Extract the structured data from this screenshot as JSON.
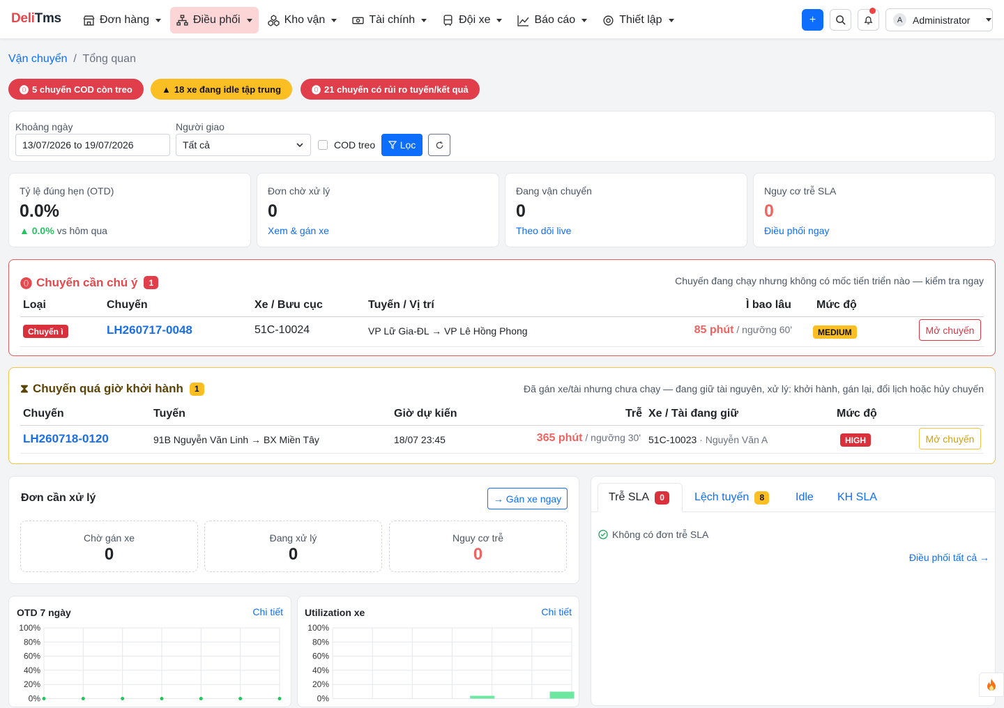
{
  "brand": {
    "a": "Deli",
    "b": "Tms"
  },
  "nav": {
    "items": [
      {
        "label": "Đơn hàng",
        "icon": "store-icon"
      },
      {
        "label": "Điều phối",
        "icon": "org-chart-icon"
      },
      {
        "label": "Kho vận",
        "icon": "boxes-icon"
      },
      {
        "label": "Tài chính",
        "icon": "cash-icon"
      },
      {
        "label": "Đội xe",
        "icon": "bus-icon"
      },
      {
        "label": "Báo cáo",
        "icon": "chart-line-icon"
      },
      {
        "label": "Thiết lập",
        "icon": "gear-icon"
      }
    ],
    "add": "+",
    "user_initial": "A",
    "user_name": "Administrator"
  },
  "breadcrumb": {
    "root": "Vận chuyển",
    "sep": "/",
    "current": "Tổng quan"
  },
  "alerts": [
    {
      "text": "5 chuyến COD còn treo",
      "color": "#e03e4a"
    },
    {
      "text": "18 xe đang idle tập trung",
      "color": "#fbbf24"
    },
    {
      "text": "21 chuyến có rủi ro tuyến/kết quả",
      "color": "#e03e4a"
    }
  ],
  "filters": {
    "date_label": "Khoảng ngày",
    "date_value": "13/07/2026 to 19/07/2026",
    "shipper_label": "Người giao",
    "shipper_value": "Tất cả",
    "cod_label": "COD treo",
    "filter_btn": "Lọc"
  },
  "kpis": [
    {
      "title": "Tỷ lệ đúng hẹn (OTD)",
      "value": "0.0%",
      "delta": "0.0%",
      "sub": "vs hôm qua"
    },
    {
      "title": "Đơn chờ xử lý",
      "value": "0",
      "link": "Xem & gán xe"
    },
    {
      "title": "Đang vận chuyển",
      "value": "0",
      "link": "Theo dõi live"
    },
    {
      "title": "Nguy cơ trễ SLA",
      "value": "0",
      "link": "Điều phối ngay"
    }
  ],
  "attention": {
    "title": "Chuyến cần chú ý",
    "count": "1",
    "note": "Chuyến đang chạy nhưng không có mốc tiến triển nào — kiểm tra ngay",
    "headers": [
      "Loại",
      "Chuyến",
      "Xe / Bưu cục",
      "Tuyến / Vị trí",
      "Ì bao lâu",
      "Mức độ"
    ],
    "row": {
      "type": "Chuyến ì",
      "trip": "LH260717-0048",
      "vehicle": "51C-10024",
      "route": "VP Lữ Gia-ĐL → VP Lê Hồng Phong",
      "duration": "85 phút",
      "threshold": "/ ngưỡng 60'",
      "level": "MEDIUM",
      "action": "Mở chuyến"
    }
  },
  "overdue": {
    "title": "Chuyến quá giờ khởi hành",
    "count": "1",
    "note": "Đã gán xe/tài nhưng chưa chạy — đang giữ tài nguyên, xử lý: khởi hành, gán lại, đổi lịch hoặc hủy chuyến",
    "headers": [
      "Chuyến",
      "Tuyến",
      "Giờ dự kiến",
      "Trễ",
      "Xe / Tài đang giữ",
      "Mức độ"
    ],
    "row": {
      "trip": "LH260718-0120",
      "route": "91B Nguyễn Văn Linh → BX Miền Tây",
      "eta": "18/07 23:45",
      "late": "365 phút",
      "threshold": "/ ngưỡng 30'",
      "vehicle": "51C-10023",
      "driver": "· Nguyễn Văn A",
      "level": "HIGH",
      "action": "Mở chuyến"
    }
  },
  "orders": {
    "title": "Đơn cần xử lý",
    "assign_btn": "Gán xe ngay",
    "boxes": [
      {
        "label": "Chờ gán xe",
        "value": "0"
      },
      {
        "label": "Đang xử lý",
        "value": "0"
      },
      {
        "label": "Nguy cơ trễ",
        "value": "0"
      }
    ]
  },
  "tabs": {
    "items": [
      {
        "label": "Trễ SLA",
        "count": "0"
      },
      {
        "label": "Lệch tuyến",
        "count": "8"
      },
      {
        "label": "Idle"
      },
      {
        "label": "KH SLA"
      }
    ],
    "empty": "Không có đơn trễ SLA",
    "all_link": "Điều phối tất cả →"
  },
  "chart_data": [
    {
      "type": "line",
      "title": "OTD 7 ngày",
      "link": "Chi tiết",
      "ylim": [
        0,
        100
      ],
      "yticks": [
        "100%",
        "80%",
        "60%",
        "40%",
        "20%",
        "0%"
      ],
      "grid": true
    },
    {
      "type": "bar",
      "title": "Utilization xe",
      "link": "Chi tiết",
      "ylim": [
        0,
        100
      ],
      "yticks": [
        "100%",
        "80%",
        "60%",
        "40%",
        "20%",
        "0%"
      ],
      "grid": true,
      "color": "#6ee7a0"
    }
  ]
}
